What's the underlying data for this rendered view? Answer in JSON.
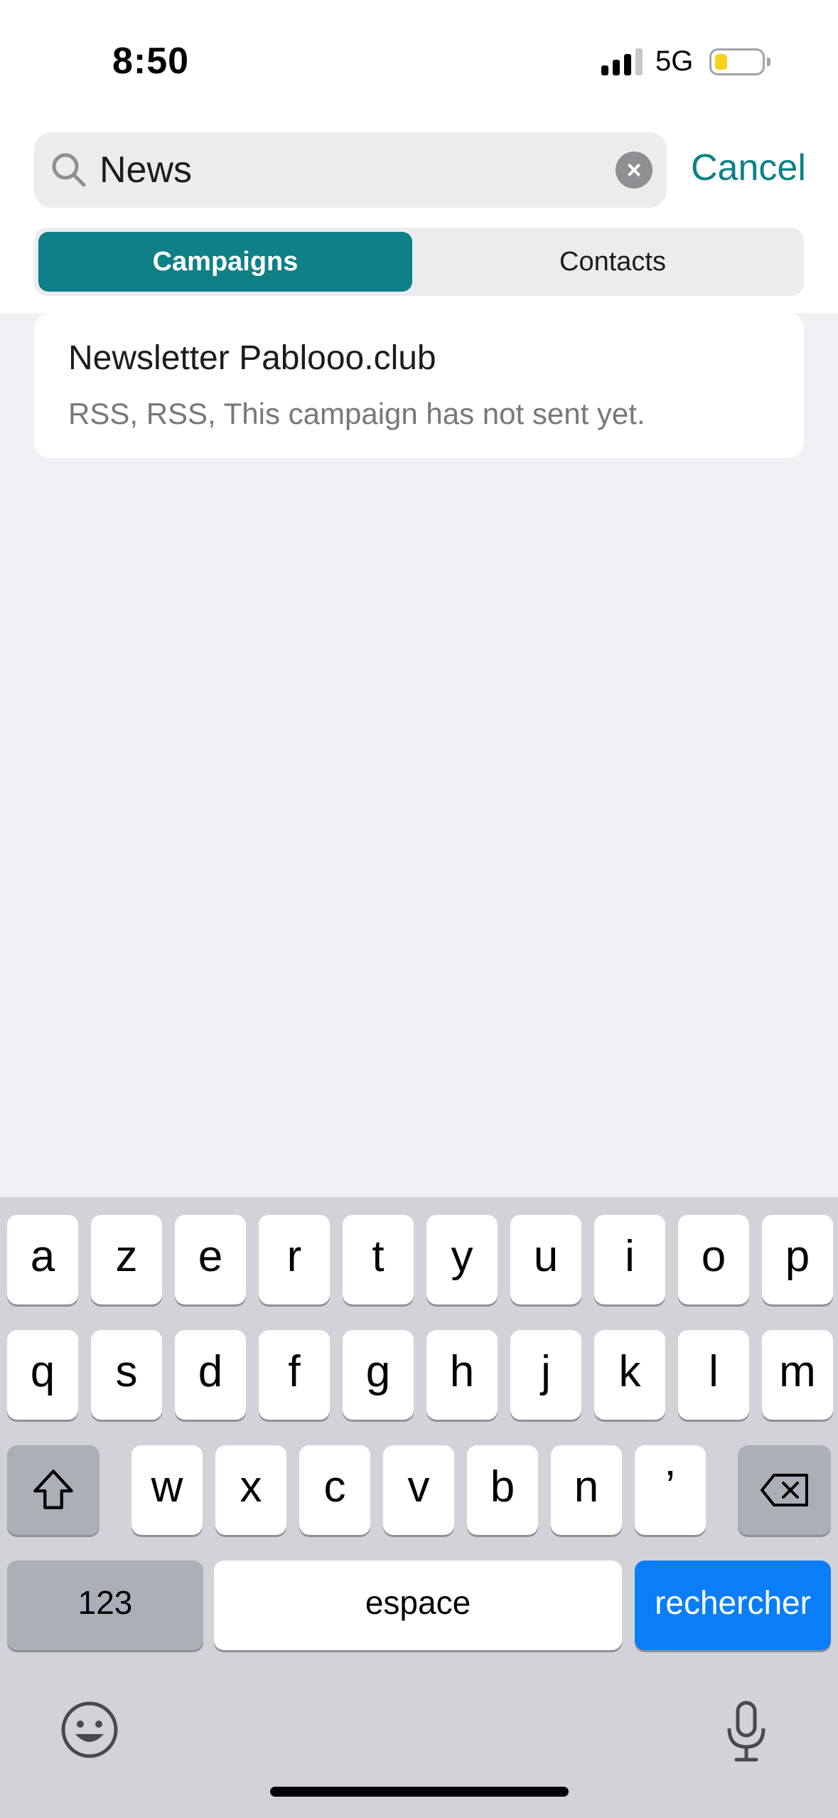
{
  "status_bar": {
    "time": "8:50",
    "network": "5G",
    "battery_level": 0.2
  },
  "search": {
    "value": "News",
    "cancel_label": "Cancel"
  },
  "segments": {
    "campaigns": "Campaigns",
    "contacts": "Contacts",
    "selected": "Campaigns"
  },
  "results": [
    {
      "title": "Newsletter Pablooo.club",
      "subtitle": "RSS, RSS, This campaign has not sent yet."
    }
  ],
  "keyboard": {
    "row1": [
      "a",
      "z",
      "e",
      "r",
      "t",
      "y",
      "u",
      "i",
      "o",
      "p"
    ],
    "row2": [
      "q",
      "s",
      "d",
      "f",
      "g",
      "h",
      "j",
      "k",
      "l",
      "m"
    ],
    "row3": [
      "w",
      "x",
      "c",
      "v",
      "b",
      "n",
      "’"
    ],
    "numbers_label": "123",
    "space_label": "espace",
    "return_label": "rechercher"
  },
  "colors": {
    "accent": "#0d8088",
    "keyboard_return": "#0a7ef8",
    "background": "#f0f0f5"
  },
  "icons": {
    "search": "search-icon",
    "clear": "clear-icon",
    "shift": "shift-icon",
    "backspace": "backspace-icon",
    "emoji": "emoji-icon",
    "mic": "microphone-icon"
  }
}
